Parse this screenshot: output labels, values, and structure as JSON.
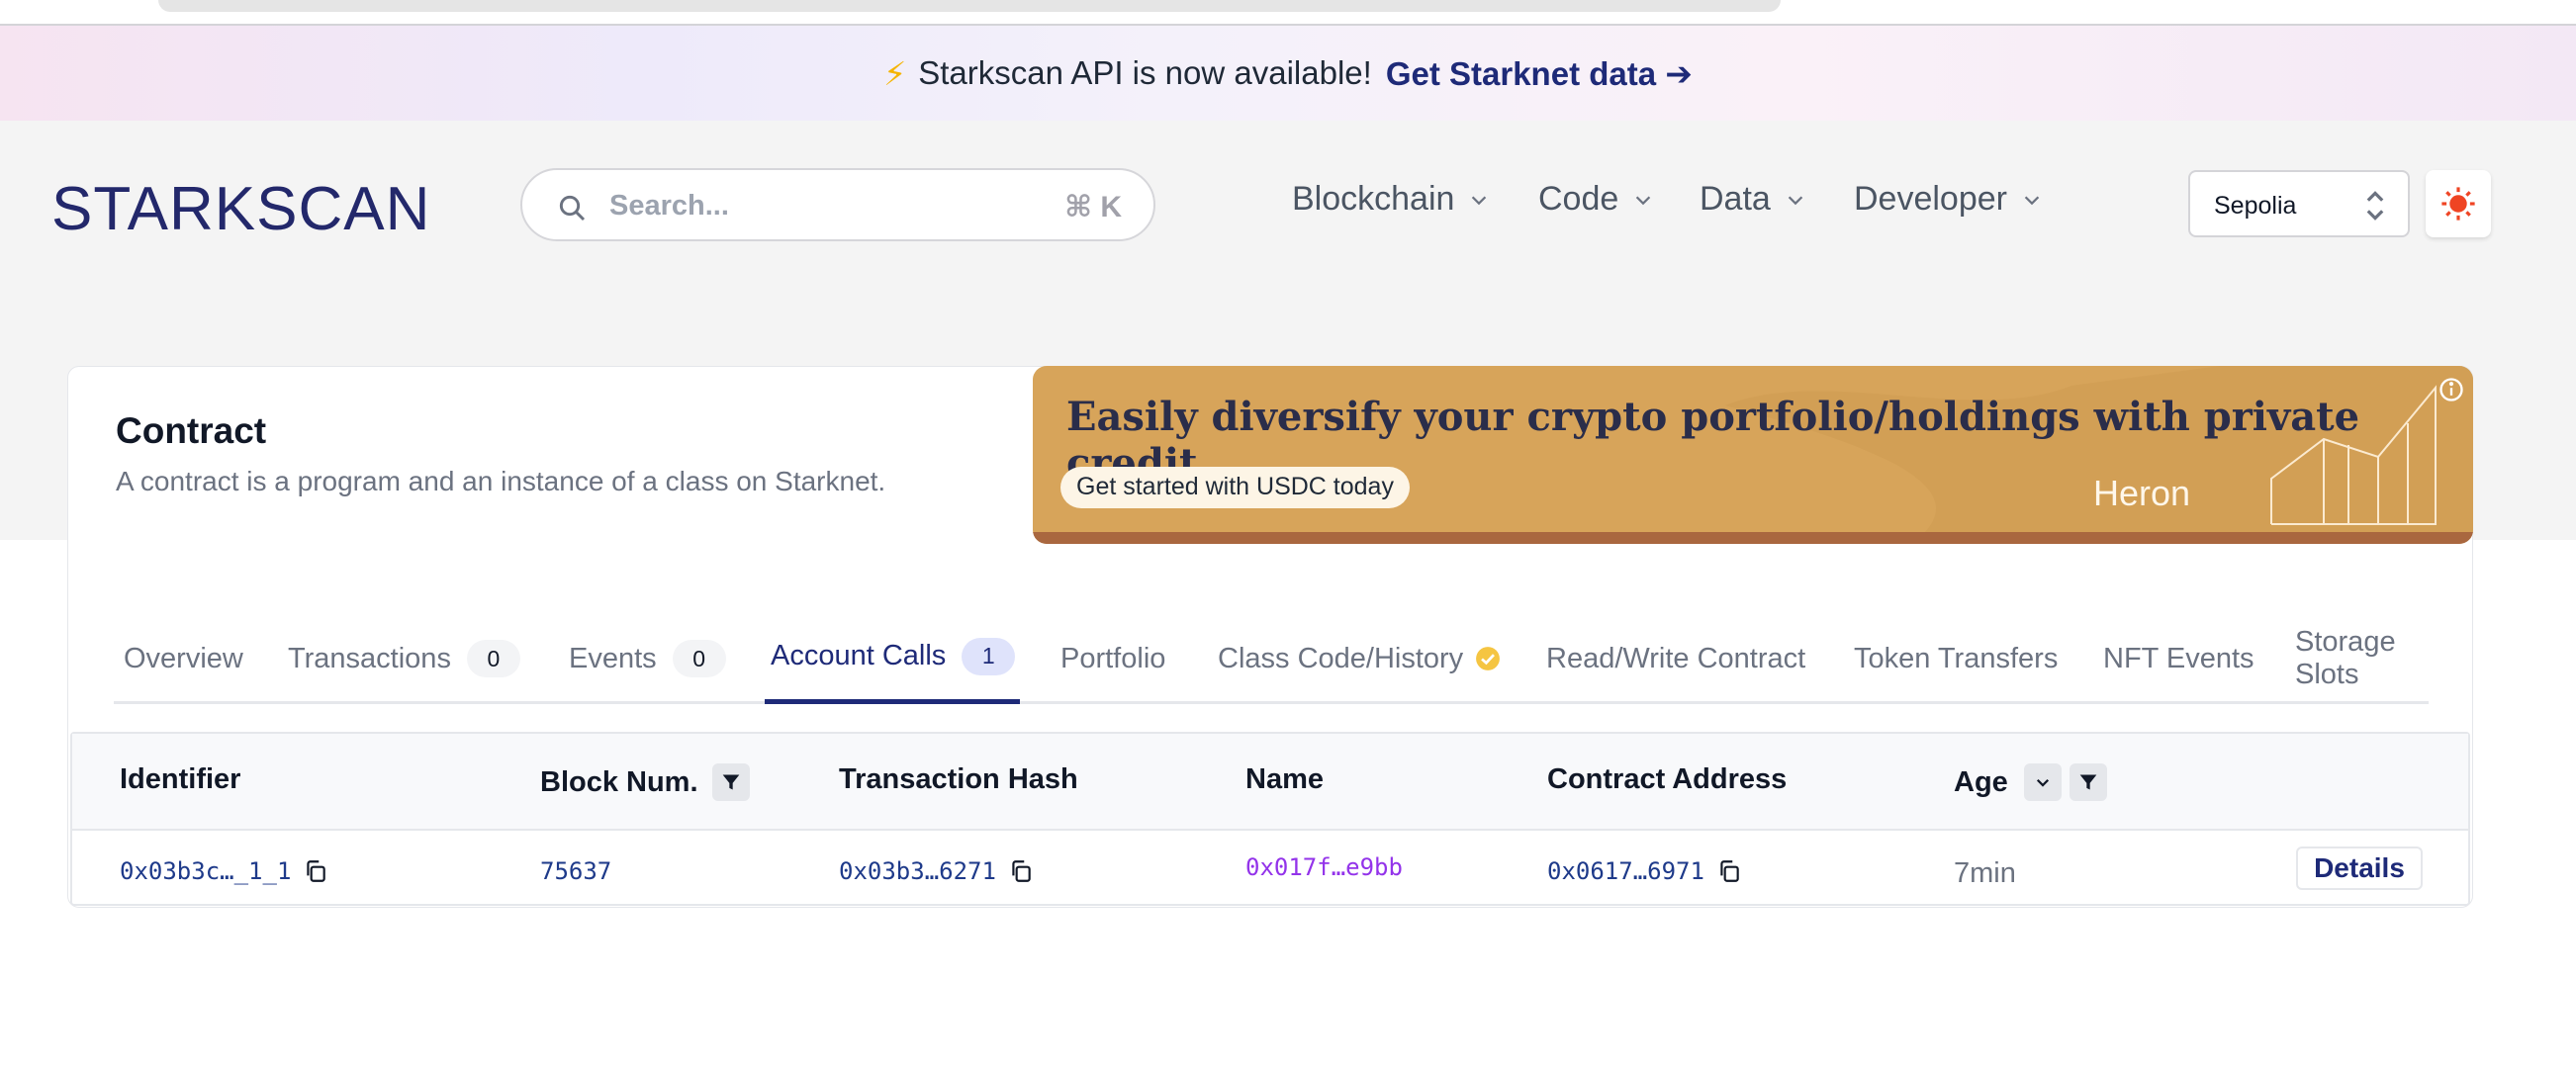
{
  "announcement": {
    "text": "Starkscan API is now available!",
    "link": "Get Starknet data ➔"
  },
  "header": {
    "logo": "STARKSCAN",
    "search": {
      "placeholder": "Search...",
      "shortcut": "⌘ K"
    },
    "nav": [
      "Blockchain",
      "Code",
      "Data",
      "Developer"
    ],
    "network": "Sepolia"
  },
  "contract": {
    "title": "Contract",
    "subtitle": "A contract is a program and an instance of a class on Starknet."
  },
  "ad": {
    "headline": "Easily diversify your crypto portfolio/holdings with private credit",
    "cta": "Get started with USDC today",
    "brand": "Heron"
  },
  "tabs": [
    {
      "label": "Overview"
    },
    {
      "label": "Transactions",
      "count": "0"
    },
    {
      "label": "Events",
      "count": "0"
    },
    {
      "label": "Account Calls",
      "count": "1"
    },
    {
      "label": "Portfolio"
    },
    {
      "label": "Class Code/History"
    },
    {
      "label": "Read/Write Contract"
    },
    {
      "label": "Token Transfers"
    },
    {
      "label": "NFT Events"
    },
    {
      "label": "Storage Slots"
    }
  ],
  "table": {
    "headers": [
      "Identifier",
      "Block Num.",
      "Transaction Hash",
      "Name",
      "Contract Address",
      "Age"
    ],
    "rows": [
      {
        "identifier": "0x03b3c…_1_1",
        "block": "75637",
        "tx_hash": "0x03b3…6271",
        "name": "0x017f…e9bb",
        "contract_address": "0x0617…6971",
        "age": "7min",
        "action": "Details"
      }
    ]
  },
  "colors": {
    "brand": "#23286b",
    "accent": "#1e2a78",
    "link": "#1e3a8a",
    "purple": "#9333ea",
    "ad_bg": "#d7a45a"
  }
}
